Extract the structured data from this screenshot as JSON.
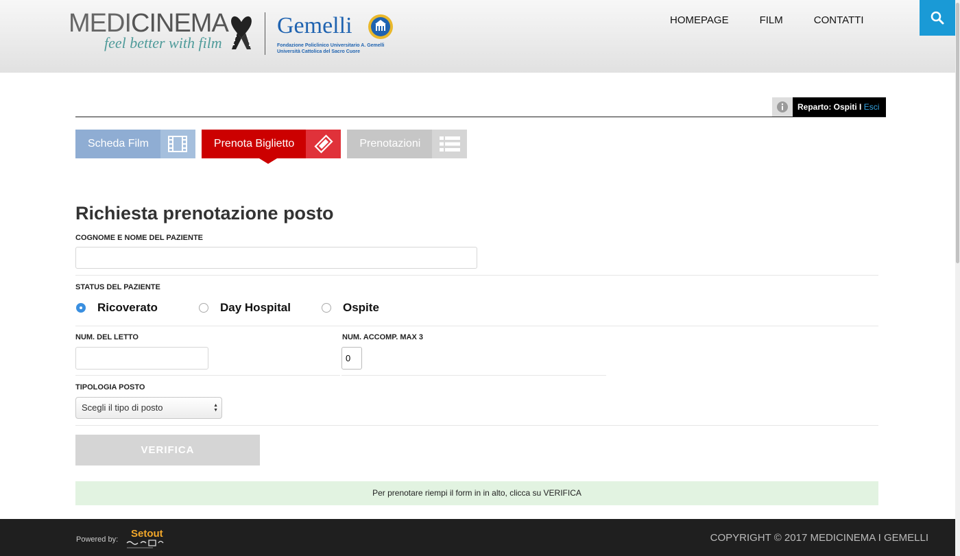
{
  "header": {
    "logo_left": "MEDI",
    "logo_right": "CINEMA",
    "logo_tagline": "feel better with film",
    "partner_name": "Gemelli",
    "partner_sub_1": "Fondazione Policlinico Universitario A. Gemelli",
    "partner_sub_2": "Università Cattolica del Sacro Cuore",
    "nav": [
      "HOMEPAGE",
      "FILM",
      "CONTATTI"
    ],
    "search_icon": "search-icon",
    "accent_color": "#1a9ad6"
  },
  "reparto": {
    "prefix": "Reparto: Ospiti I ",
    "logout": "Esci",
    "info_icon": "info-icon"
  },
  "tabs": [
    {
      "label": "Scheda Film",
      "icon": "film-icon",
      "color": "#8fadd3"
    },
    {
      "label": "Prenota Biglietto",
      "icon": "ticket-icon",
      "color": "#cc0000",
      "active": true
    },
    {
      "label": "Prenotazioni",
      "icon": "list-icon",
      "color": "#c6c6c6"
    }
  ],
  "form": {
    "title": "Richiesta prenotazione posto",
    "patient_name_label": "COGNOME E NOME DEL PAZIENTE",
    "patient_name_value": "",
    "status_label": "STATUS DEL PAZIENTE",
    "status_options": [
      {
        "label": "Ricoverato",
        "checked": true
      },
      {
        "label": "Day Hospital",
        "checked": false
      },
      {
        "label": "Ospite",
        "checked": false
      }
    ],
    "bed_label": "NUM. DEL LETTO",
    "bed_value": "",
    "companions_label": "NUM. ACCOMP. MAX 3",
    "companions_value": "0",
    "seat_type_label": "TIPOLOGIA POSTO",
    "seat_type_selected": "Scegli il tipo di posto",
    "verify_button": "VERIFICA",
    "notice": "Per prenotare riempi il form in in alto, clicca su VERIFICA"
  },
  "footer": {
    "powered_by": "Powered by:",
    "powered_logo": "Setout",
    "copyright": "COPYRIGHT © 2017 MEDICINEMA I GEMELLI"
  }
}
